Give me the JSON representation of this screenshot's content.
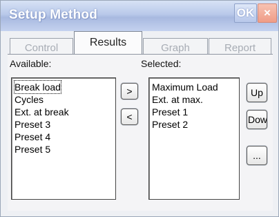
{
  "window": {
    "title": "Setup Method",
    "ok_label": "OK",
    "close_label": "×"
  },
  "tabs": [
    {
      "label": "Control",
      "active": false
    },
    {
      "label": "Results",
      "active": true
    },
    {
      "label": "Graph",
      "active": false
    },
    {
      "label": "Report",
      "active": false
    }
  ],
  "available": {
    "label": "Available:",
    "items": [
      "Break load",
      "Cycles",
      "Ext. at break",
      "Preset 3",
      "Preset 4",
      "Preset 5"
    ],
    "focused_index": 0
  },
  "selected": {
    "label": "Selected:",
    "items": [
      "Maximum Load",
      "Ext. at max.",
      "Preset 1",
      "Preset 2"
    ]
  },
  "buttons": {
    "add": ">",
    "remove": "<",
    "up": "Up",
    "down": "Dowr",
    "more": "..."
  }
}
